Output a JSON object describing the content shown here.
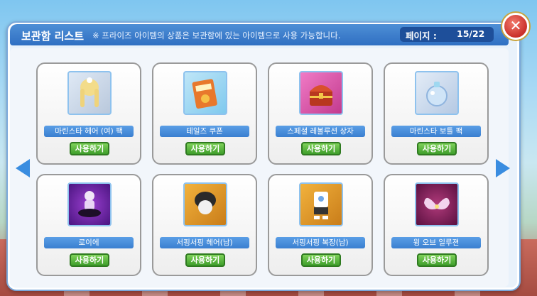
{
  "header": {
    "title": "보관함 리스트",
    "notice": "※ 프라이즈 아이템의 상품은 보관함에 있는 아이템으로 사용 가능합니다.",
    "page_label": "페이지 :",
    "page_value": "15/22"
  },
  "close_label": "✕",
  "items": [
    {
      "name": "마린스타 헤어 (여) 팩",
      "button": "사용하기",
      "icon": "blonde-hair-icon"
    },
    {
      "name": "테일즈 쿠폰",
      "button": "사용하기",
      "icon": "coupon-icon"
    },
    {
      "name": "스페셜 레볼루션 상자",
      "button": "사용하기",
      "icon": "treasure-chest-icon"
    },
    {
      "name": "마린스타 보틀 팩",
      "button": "사용하기",
      "icon": "bottle-icon"
    },
    {
      "name": "로이에",
      "button": "사용하기",
      "icon": "character-icon"
    },
    {
      "name": "서핑서핑 헤어(남)",
      "button": "사용하기",
      "icon": "male-hair-icon"
    },
    {
      "name": "서핑서핑 복장(남)",
      "button": "사용하기",
      "icon": "outfit-icon"
    },
    {
      "name": "윙 오브 일루젼",
      "button": "사용하기",
      "icon": "wings-icon"
    }
  ],
  "colors": {
    "header_blue": "#2f6fc2",
    "name_bar_blue": "#3a7fd0",
    "use_button_green": "#3f9e2b",
    "close_red": "#c9302a"
  }
}
